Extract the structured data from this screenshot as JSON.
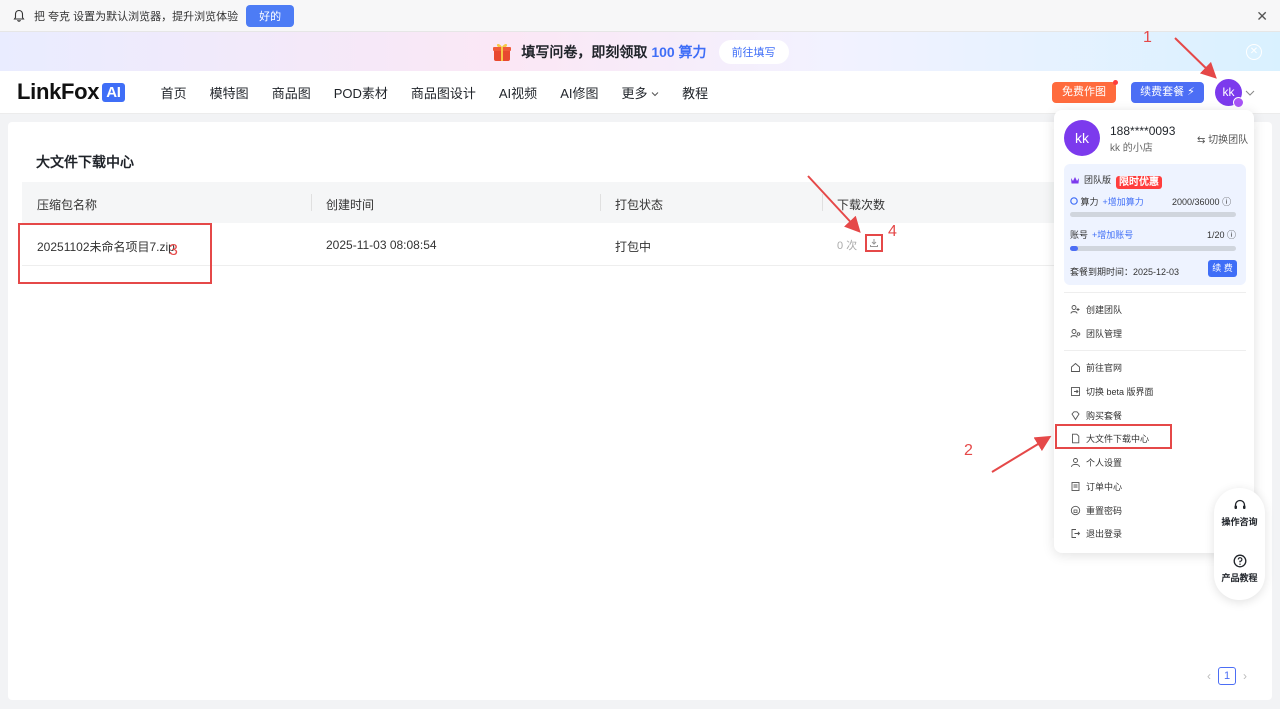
{
  "browser_banner": {
    "text": "把 夸克 设置为默认浏览器，提升浏览体验",
    "ok_label": "好的",
    "close": "✕"
  },
  "promo": {
    "text_prefix": "填写问卷，即刻领取",
    "amount": "100 算力",
    "button": "前往填写",
    "close": "✕"
  },
  "header": {
    "logo_text": "LinkFox",
    "logo_badge": "AI",
    "nav": [
      "首页",
      "模特图",
      "商品图",
      "POD素材",
      "商品图设计",
      "AI视频",
      "AI修图",
      "更多",
      "教程"
    ],
    "free_button": "免费作图",
    "renew_button": "续费套餐 ⚡",
    "avatar": "kk"
  },
  "main": {
    "title": "大文件下载中心",
    "columns": [
      "压缩包名称",
      "创建时间",
      "打包状态",
      "下载次数"
    ],
    "rows": [
      {
        "name": "20251102未命名项目7.zip",
        "created": "2025-11-03 08:08:54",
        "status": "打包中",
        "downloads": "0 次"
      }
    ],
    "page": "1",
    "prev": "‹",
    "next": "›"
  },
  "dropdown": {
    "avatar": "kk",
    "phone": "188****0093",
    "shop": "kk 的小店",
    "switch_team": "切换团队",
    "plan_name": "团队版",
    "promo_tag": "限时优惠",
    "compute_label": "算力",
    "compute_add": "+增加算力",
    "compute_value": "2000/36000",
    "compute_fraction": 0.0,
    "account_label": "账号",
    "account_add": "+增加账号",
    "account_value": "1/20",
    "account_fraction": 0.05,
    "expiry": "套餐到期时间：2025-12-03",
    "renew": "续 费",
    "menu_team": [
      "创建团队",
      "团队管理"
    ],
    "menu_main": [
      "前往官网",
      "切换 beta 版界面",
      "购买套餐",
      "大文件下载中心",
      "个人设置",
      "订单中心",
      "重置密码",
      "退出登录"
    ]
  },
  "float_panel": {
    "consult": "操作咨询",
    "tutorial": "产品教程"
  },
  "annotations": {
    "n1": "1",
    "n2": "2",
    "n3": "3",
    "n4": "4",
    "color": "#e54848"
  }
}
